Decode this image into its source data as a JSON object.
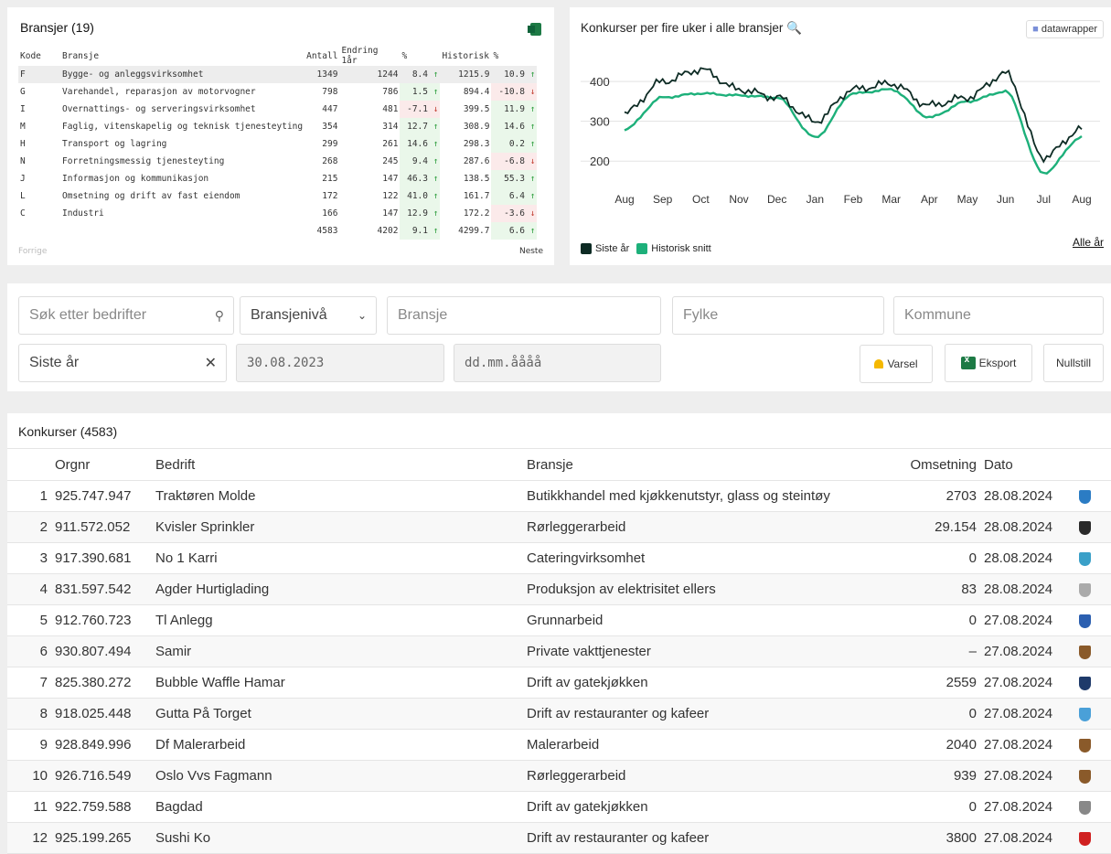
{
  "bransjer": {
    "title": "Bransjer (19)",
    "headers": [
      "Kode",
      "Bransje",
      "Antall",
      "Endring 1år",
      "%",
      "Historisk",
      "%"
    ],
    "rows": [
      {
        "kode": "F",
        "bransje": "Bygge- og anleggsvirksomhet",
        "antall": "1349",
        "endring": "1244",
        "pct1": "8.4",
        "dir1": "up",
        "hist": "1215.9",
        "pct2": "10.9",
        "dir2": "up"
      },
      {
        "kode": "G",
        "bransje": "Varehandel, reparasjon av motorvogner",
        "antall": "798",
        "endring": "786",
        "pct1": "1.5",
        "dir1": "up",
        "hist": "894.4",
        "pct2": "-10.8",
        "dir2": "down"
      },
      {
        "kode": "I",
        "bransje": "Overnattings- og serveringsvirksomhet",
        "antall": "447",
        "endring": "481",
        "pct1": "-7.1",
        "dir1": "down",
        "hist": "399.5",
        "pct2": "11.9",
        "dir2": "up"
      },
      {
        "kode": "M",
        "bransje": "Faglig, vitenskapelig og teknisk tjenesteyting",
        "antall": "354",
        "endring": "314",
        "pct1": "12.7",
        "dir1": "up",
        "hist": "308.9",
        "pct2": "14.6",
        "dir2": "up"
      },
      {
        "kode": "H",
        "bransje": "Transport og lagring",
        "antall": "299",
        "endring": "261",
        "pct1": "14.6",
        "dir1": "up",
        "hist": "298.3",
        "pct2": "0.2",
        "dir2": "up"
      },
      {
        "kode": "N",
        "bransje": "Forretningsmessig tjenesteyting",
        "antall": "268",
        "endring": "245",
        "pct1": "9.4",
        "dir1": "up",
        "hist": "287.6",
        "pct2": "-6.8",
        "dir2": "down"
      },
      {
        "kode": "J",
        "bransje": "Informasjon og kommunikasjon",
        "antall": "215",
        "endring": "147",
        "pct1": "46.3",
        "dir1": "up",
        "hist": "138.5",
        "pct2": "55.3",
        "dir2": "up"
      },
      {
        "kode": "L",
        "bransje": "Omsetning og drift av fast eiendom",
        "antall": "172",
        "endring": "122",
        "pct1": "41.0",
        "dir1": "up",
        "hist": "161.7",
        "pct2": "6.4",
        "dir2": "up"
      },
      {
        "kode": "C",
        "bransje": "Industri",
        "antall": "166",
        "endring": "147",
        "pct1": "12.9",
        "dir1": "up",
        "hist": "172.2",
        "pct2": "-3.6",
        "dir2": "down"
      }
    ],
    "total": {
      "antall": "4583",
      "endring": "4202",
      "pct1": "9.1",
      "dir1": "up",
      "hist": "4299.7",
      "pct2": "6.6",
      "dir2": "up"
    },
    "prev_label": "Forrige",
    "next_label": "Neste"
  },
  "chart": {
    "title": "Konkurser per fire uker i alle bransjer",
    "badge": "datawrapper",
    "all_years_link": "Alle år",
    "legend": [
      {
        "label": "Siste år",
        "color": "#0d2b24"
      },
      {
        "label": "Historisk snitt",
        "color": "#1db07a"
      }
    ]
  },
  "chart_data": {
    "type": "line",
    "x": [
      "Aug",
      "Sep",
      "Oct",
      "Nov",
      "Dec",
      "Jan",
      "Feb",
      "Mar",
      "Apr",
      "May",
      "Jun",
      "Jul",
      "Aug"
    ],
    "series": [
      {
        "name": "Siste år",
        "color": "#0d2b24",
        "values": [
          320,
          400,
          430,
          380,
          360,
          300,
          380,
          395,
          340,
          360,
          420,
          210,
          280
        ]
      },
      {
        "name": "Historisk snitt",
        "color": "#1db07a",
        "values": [
          280,
          360,
          370,
          365,
          360,
          260,
          370,
          380,
          310,
          350,
          375,
          170,
          260
        ]
      }
    ],
    "yticks": [
      200,
      300,
      400
    ],
    "ylim": [
      150,
      460
    ]
  },
  "filters": {
    "search_placeholder": "Søk etter bedrifter",
    "level_value": "Bransjenivå",
    "bransje_placeholder": "Bransje",
    "fylke_placeholder": "Fylke",
    "kommune_placeholder": "Kommune",
    "period_value": "Siste år",
    "from_date": "30.08.2023",
    "to_date_placeholder": "dd.mm.åååå",
    "varsel_label": "Varsel",
    "eksport_label": "Eksport",
    "reset_label": "Nullstill"
  },
  "konkurser": {
    "title": "Konkurser (4583)",
    "headers": [
      "Orgnr",
      "Bedrift",
      "Bransje",
      "Omsetning",
      "Dato"
    ],
    "rows": [
      {
        "n": "1",
        "orgnr": "925.747.947",
        "bedrift": "Traktøren Molde",
        "bransje": "Butikkhandel med kjøkkenutstyr, glass og steintøy",
        "oms": "2703",
        "dato": "28.08.2024",
        "crest": "#2b7cc4"
      },
      {
        "n": "2",
        "orgnr": "911.572.052",
        "bedrift": "Kvisler Sprinkler",
        "bransje": "Rørleggerarbeid",
        "oms": "29.154",
        "dato": "28.08.2024",
        "crest": "#2a2a2a"
      },
      {
        "n": "3",
        "orgnr": "917.390.681",
        "bedrift": "No 1 Karri",
        "bransje": "Cateringvirksomhet",
        "oms": "0",
        "dato": "28.08.2024",
        "crest": "#3aa0c8"
      },
      {
        "n": "4",
        "orgnr": "831.597.542",
        "bedrift": "Agder Hurtiglading",
        "bransje": "Produksjon av elektrisitet ellers",
        "oms": "83",
        "dato": "28.08.2024",
        "crest": "#aaaaaa"
      },
      {
        "n": "5",
        "orgnr": "912.760.723",
        "bedrift": "Tl Anlegg",
        "bransje": "Grunnarbeid",
        "oms": "0",
        "dato": "27.08.2024",
        "crest": "#2b5fb0"
      },
      {
        "n": "6",
        "orgnr": "930.807.494",
        "bedrift": "Samir",
        "bransje": "Private vakttjenester",
        "oms": "–",
        "dato": "27.08.2024",
        "crest": "#8a5a2a"
      },
      {
        "n": "7",
        "orgnr": "825.380.272",
        "bedrift": "Bubble Waffle Hamar",
        "bransje": "Drift av gatekjøkken",
        "oms": "2559",
        "dato": "27.08.2024",
        "crest": "#1e3a6a"
      },
      {
        "n": "8",
        "orgnr": "918.025.448",
        "bedrift": "Gutta På Torget",
        "bransje": "Drift av restauranter og kafeer",
        "oms": "0",
        "dato": "27.08.2024",
        "crest": "#4aa0d8"
      },
      {
        "n": "9",
        "orgnr": "928.849.996",
        "bedrift": "Df Malerarbeid",
        "bransje": "Malerarbeid",
        "oms": "2040",
        "dato": "27.08.2024",
        "crest": "#8a5a2a"
      },
      {
        "n": "10",
        "orgnr": "926.716.549",
        "bedrift": "Oslo Vvs Fagmann",
        "bransje": "Rørleggerarbeid",
        "oms": "939",
        "dato": "27.08.2024",
        "crest": "#8a5a2a"
      },
      {
        "n": "11",
        "orgnr": "922.759.588",
        "bedrift": "Bagdad",
        "bransje": "Drift av gatekjøkken",
        "oms": "0",
        "dato": "27.08.2024",
        "crest": "#888888"
      },
      {
        "n": "12",
        "orgnr": "925.199.265",
        "bedrift": "Sushi Ko",
        "bransje": "Drift av restauranter og kafeer",
        "oms": "3800",
        "dato": "27.08.2024",
        "crest": "#d02020"
      }
    ]
  }
}
